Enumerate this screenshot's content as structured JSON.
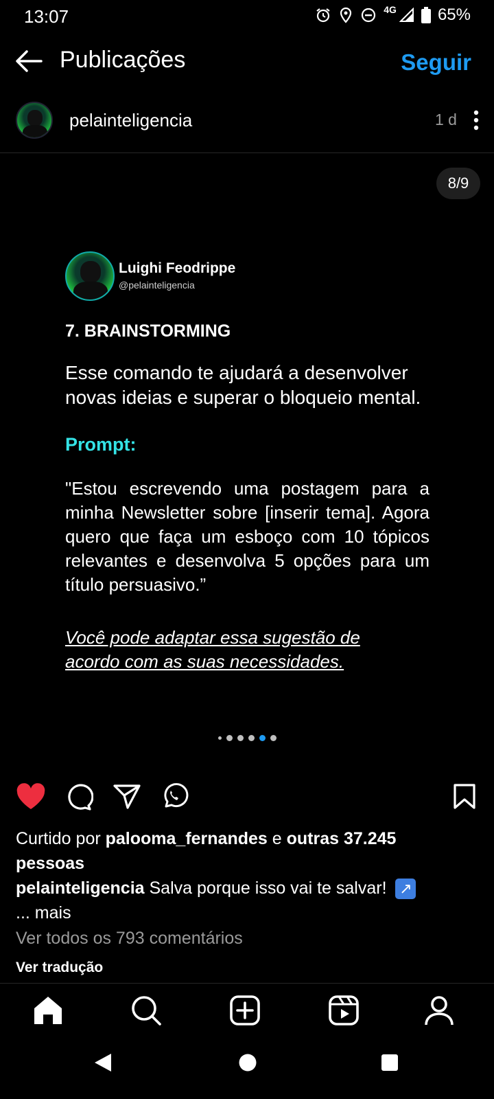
{
  "status_bar": {
    "time": "13:07",
    "network": "4G",
    "battery": "65%"
  },
  "header": {
    "title": "Publicações",
    "follow_label": "Seguir"
  },
  "post": {
    "username": "pelainteligencia",
    "time": "1 d",
    "page_counter": "8/9"
  },
  "slide": {
    "author_name": "Luighi Feodrippe",
    "author_handle": "@pelainteligencia",
    "heading": "7. BRAINSTORMING",
    "description": "Esse comando te ajudará a desenvolver novas ideias e superar o bloqueio mental.",
    "prompt_label": "Prompt:",
    "prompt_text": "\"Estou escrevendo uma postagem para a minha Newsletter sobre [inserir tema]. Agora quero que faça um esboço com 10 tópicos relevantes e desenvolva 5 opções para um título persuasivo.”",
    "note": "Você pode adaptar essa sugestão de acordo com as suas necessidades."
  },
  "carousel": {
    "active_dot": 5
  },
  "engagement": {
    "liked_prefix": "Curtido por ",
    "liked_user": "palooma_fernandes",
    "liked_middle": " e ",
    "liked_others": "outras 37.245 pessoas",
    "caption_user": "pelainteligencia",
    "caption_text": " Salva porque isso vai te salvar! ",
    "more_label": "... mais",
    "view_comments": "Ver todos os 793 comentários",
    "translate": "Ver tradução"
  },
  "icons": {
    "like": "heart-icon",
    "comment": "comment-icon",
    "share": "send-icon",
    "whatsapp": "whatsapp-icon",
    "save": "bookmark-icon",
    "accent": "#1e9bf2",
    "like_color": "#ed2e3f",
    "prompt_color": "#34e3e6"
  }
}
